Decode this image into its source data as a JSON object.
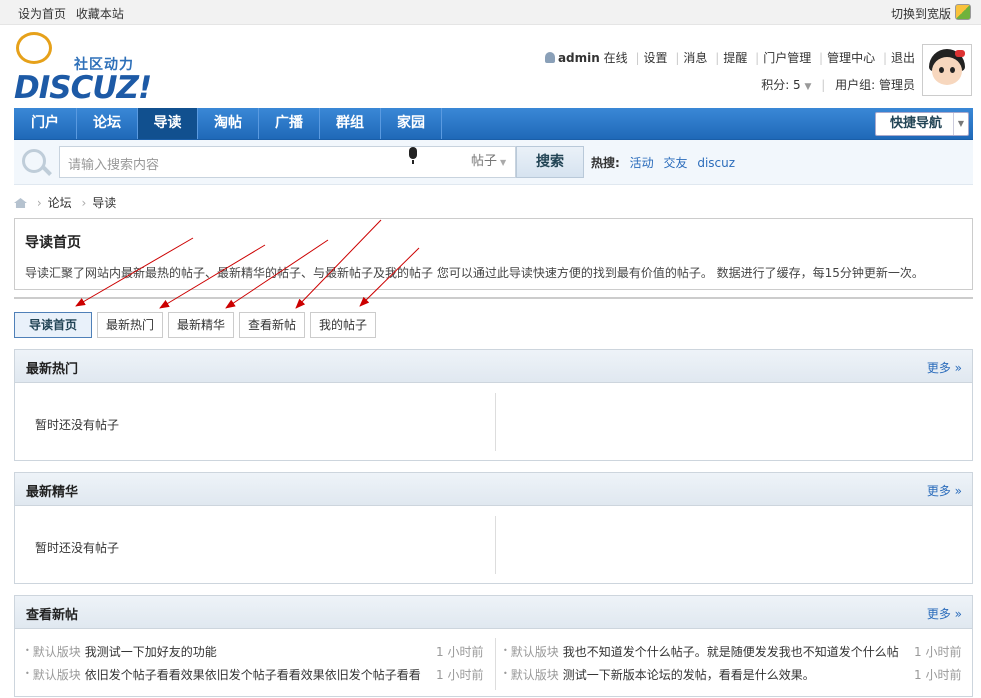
{
  "topbar": {
    "set_home": "设为首页",
    "bookmark": "收藏本站",
    "switch_wide": "切换到宽版"
  },
  "logo": {
    "slogan": "社区动力",
    "word": "DISCUZ!"
  },
  "usernav": {
    "username": "admin",
    "status": "在线",
    "links": [
      "设置",
      "消息",
      "提醒",
      "门户管理",
      "管理中心",
      "退出"
    ]
  },
  "userinfo": {
    "points": "积分: 5",
    "usergroup": "用户组: 管理员"
  },
  "nav": {
    "items": [
      "门户",
      "论坛",
      "导读",
      "淘帖",
      "广播",
      "群组",
      "家园"
    ],
    "active": "导读",
    "quicknav": "快捷导航"
  },
  "search": {
    "placeholder": "请输入搜索内容",
    "category": "帖子",
    "button": "搜索",
    "hot_label": "热搜:",
    "hot_terms": [
      "活动",
      "交友",
      "discuz"
    ]
  },
  "breadcrumb": [
    "论坛",
    "导读"
  ],
  "intro": {
    "title": "导读首页",
    "desc": "导读汇聚了网站内最新最热的帖子、最新精华的帖子、与最新帖子及我的帖子 您可以通过此导读快速方便的找到最有价值的帖子。 数据进行了缓存，每15分钟更新一次。"
  },
  "tabs": [
    "导读首页",
    "最新热门",
    "最新精华",
    "查看新帖",
    "我的帖子"
  ],
  "panels": {
    "hot": {
      "title": "最新热门",
      "more": "更多 »",
      "empty": "暂时还没有帖子"
    },
    "digest": {
      "title": "最新精华",
      "more": "更多 »",
      "empty": "暂时还没有帖子"
    },
    "new": {
      "title": "查看新帖",
      "more": "更多 »",
      "posts": [
        {
          "forum": "默认版块",
          "title": "我测试一下加好友的功能",
          "time": "1 小时前"
        },
        {
          "forum": "默认版块",
          "title": "我也不知道发个什么帖子。就是随便发发我也不知道发个什么帖",
          "time": "1 小时前"
        },
        {
          "forum": "默认版块",
          "title": "依旧发个帖子看看效果依旧发个帖子看看效果依旧发个帖子看看",
          "time": "1 小时前"
        },
        {
          "forum": "默认版块",
          "title": "测试一下新版本论坛的发帖，看看是什么效果。",
          "time": "1 小时前"
        }
      ]
    }
  },
  "colors": {
    "nav_blue": "#2b7acd",
    "link_blue": "#2b6cbb",
    "arrow_red": "#cc0000"
  }
}
